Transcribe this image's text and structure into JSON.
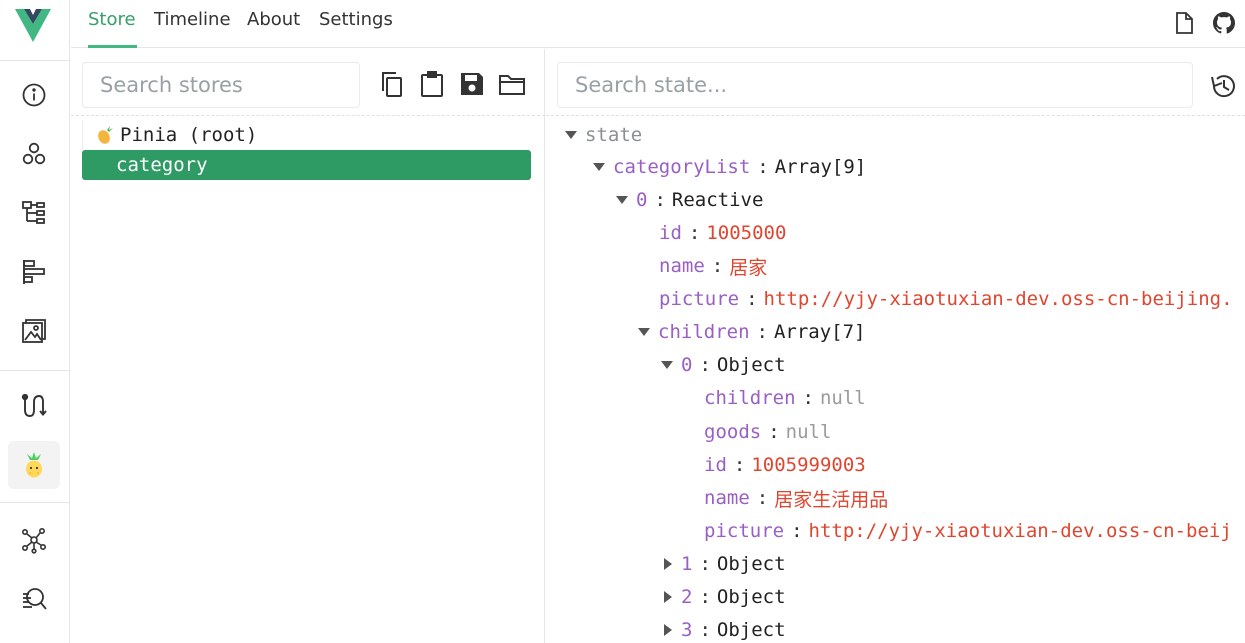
{
  "nav": {
    "tabs": [
      {
        "label": "Store"
      },
      {
        "label": "Timeline"
      },
      {
        "label": "About"
      },
      {
        "label": "Settings"
      }
    ]
  },
  "rail": {
    "icons": [
      "info-icon",
      "components-icon",
      "tree-icon",
      "timeline-icon",
      "assets-icon",
      "routes-icon",
      "pinia-icon",
      "graph-icon",
      "inspect-icon"
    ]
  },
  "colors": {
    "accent": "#42b883",
    "selected_row": "#2e9a64",
    "key": "#9a5fc4",
    "value": "#e0462f"
  },
  "stores": {
    "search_placeholder": "Search stores",
    "items": [
      {
        "label": "Pinia (root)"
      },
      {
        "label": "category"
      }
    ]
  },
  "state": {
    "search_placeholder": "Search state...",
    "root": "state",
    "sep": ":",
    "categoryList": {
      "key": "categoryList",
      "type": "Array[9]"
    },
    "item0": {
      "key": "0",
      "type": "Reactive"
    },
    "id": {
      "key": "id",
      "value": "1005000"
    },
    "name": {
      "key": "name",
      "value": "居家"
    },
    "picture": {
      "key": "picture",
      "value": "http://yjy-xiaotuxian-dev.oss-cn-beijing."
    },
    "children": {
      "key": "children",
      "type": "Array[7]"
    },
    "child0": {
      "key": "0",
      "type": "Object"
    },
    "c_children": {
      "key": "children",
      "value": "null"
    },
    "c_goods": {
      "key": "goods",
      "value": "null"
    },
    "c_id": {
      "key": "id",
      "value": "1005999003"
    },
    "c_name": {
      "key": "name",
      "value": "居家生活用品"
    },
    "c_picture": {
      "key": "picture",
      "value": "http://yjy-xiaotuxian-dev.oss-cn-beij"
    },
    "child1": {
      "key": "1",
      "type": "Object"
    },
    "child2": {
      "key": "2",
      "type": "Object"
    },
    "child3": {
      "key": "3",
      "type": "Object"
    }
  }
}
